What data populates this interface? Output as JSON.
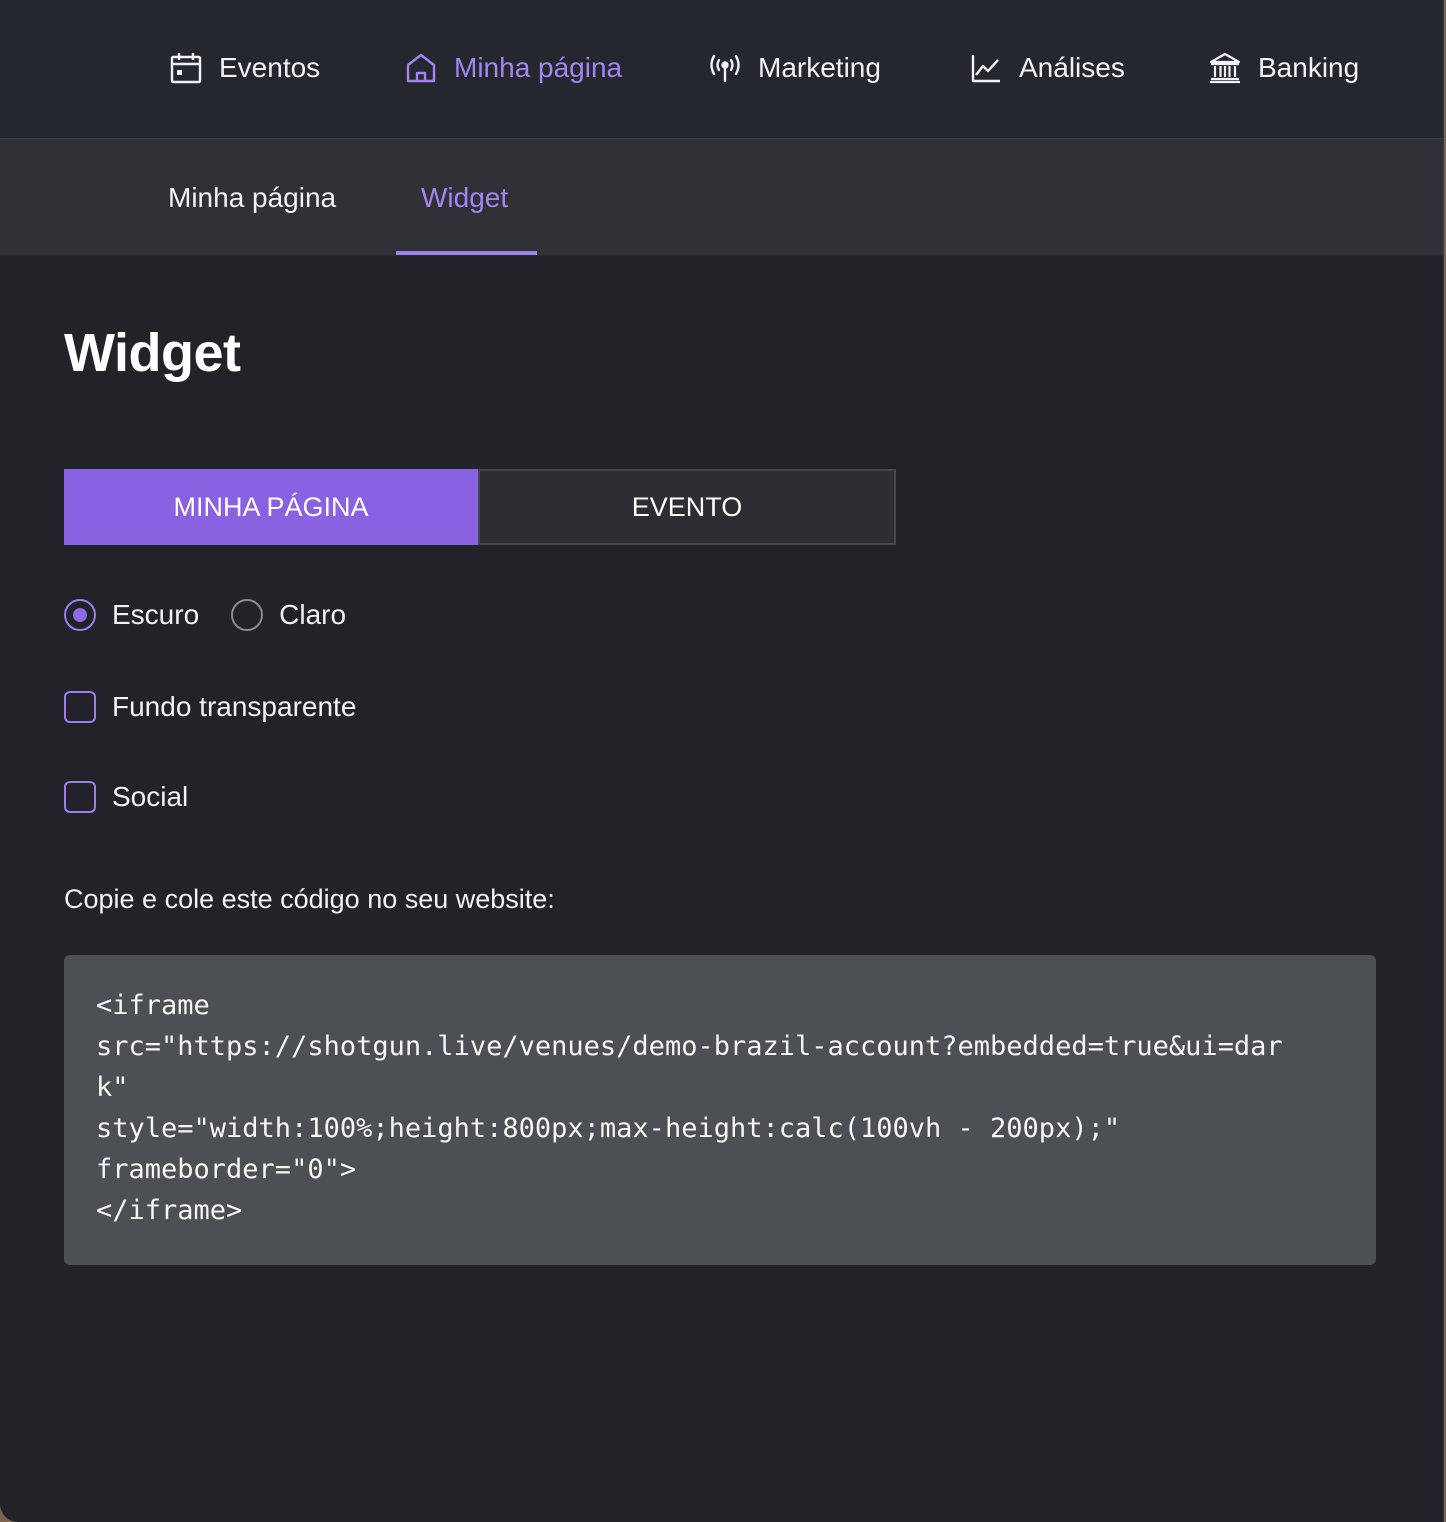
{
  "topnav": {
    "items": [
      {
        "label": "Eventos",
        "icon": "calendar-icon",
        "active": false
      },
      {
        "label": "Minha página",
        "icon": "home-icon",
        "active": true
      },
      {
        "label": "Marketing",
        "icon": "broadcast-icon",
        "active": false
      },
      {
        "label": "Análises",
        "icon": "line-chart-icon",
        "active": false
      },
      {
        "label": "Banking",
        "icon": "bank-icon",
        "active": false
      }
    ]
  },
  "subnav": {
    "tabs": [
      {
        "label": "Minha página",
        "active": false
      },
      {
        "label": "Widget",
        "active": true
      }
    ]
  },
  "page": {
    "title": "Widget",
    "segment": {
      "options": [
        "MINHA PÁGINA",
        "EVENTO"
      ],
      "selected": "MINHA PÁGINA"
    },
    "theme": {
      "options": [
        "Escuro",
        "Claro"
      ],
      "selected": "Escuro"
    },
    "transparent_bg": {
      "label": "Fundo transparente",
      "checked": false
    },
    "social": {
      "label": "Social",
      "checked": false
    },
    "copy_hint": "Copie e cole este código no seu website:",
    "code_lines": [
      "<iframe",
      "src=\"https://shotgun.live/venues/demo-brazil-account?embedded=true&ui=dar",
      "k\"",
      "style=\"width:100%;height:800px;max-height:calc(100vh - 200px);\"",
      "frameborder=\"0\">",
      "</iframe>"
    ]
  },
  "colors": {
    "accent": "#8862e0",
    "accent_text": "#a384f0",
    "background": "#212329",
    "code_bg": "#4c4f53"
  }
}
